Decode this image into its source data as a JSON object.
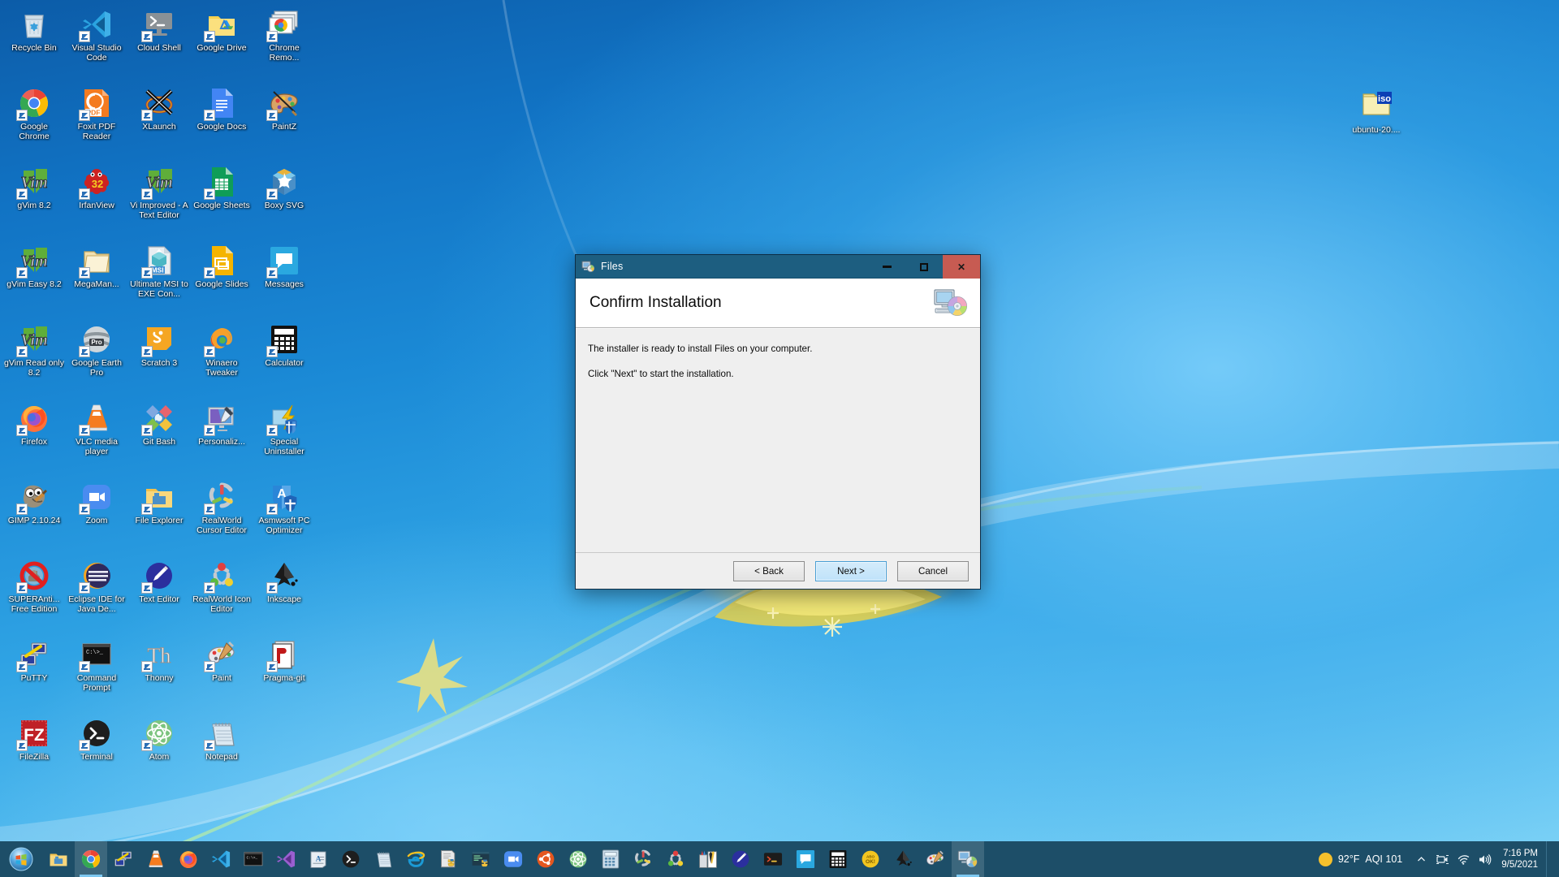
{
  "desktop": {
    "icons": [
      {
        "label": "Recycle Bin",
        "icon": "recycle-bin-icon",
        "shortcut": false
      },
      {
        "label": "Visual Studio Code",
        "icon": "vscode-icon",
        "shortcut": true
      },
      {
        "label": "Cloud Shell",
        "icon": "cloud-shell-icon",
        "shortcut": true
      },
      {
        "label": "Google Drive",
        "icon": "google-drive-icon",
        "shortcut": true
      },
      {
        "label": "Chrome Remo...",
        "icon": "chrome-remote-desktop-icon",
        "shortcut": true
      },
      {
        "label": "Google Chrome",
        "icon": "google-chrome-icon",
        "shortcut": true
      },
      {
        "label": "Foxit PDF Reader",
        "icon": "foxit-pdf-reader-icon",
        "shortcut": true
      },
      {
        "label": "XLaunch",
        "icon": "xlaunch-icon",
        "shortcut": true
      },
      {
        "label": "Google Docs",
        "icon": "google-docs-icon",
        "shortcut": true
      },
      {
        "label": "PaintZ",
        "icon": "paintz-icon",
        "shortcut": true
      },
      {
        "label": "gVim 8.2",
        "icon": "gvim-icon",
        "shortcut": true
      },
      {
        "label": "IrfanView",
        "icon": "irfanview-icon",
        "shortcut": true
      },
      {
        "label": "Vi Improved - A Text Editor",
        "icon": "vim-icon",
        "shortcut": true
      },
      {
        "label": "Google Sheets",
        "icon": "google-sheets-icon",
        "shortcut": true
      },
      {
        "label": "Boxy SVG",
        "icon": "boxy-svg-icon",
        "shortcut": true
      },
      {
        "label": "gVim Easy 8.2",
        "icon": "gvim-easy-icon",
        "shortcut": true
      },
      {
        "label": "MegaMan...",
        "icon": "folder-icon",
        "shortcut": true
      },
      {
        "label": "Ultimate MSI to EXE Con...",
        "icon": "msi-to-exe-icon",
        "shortcut": true
      },
      {
        "label": "Google Slides",
        "icon": "google-slides-icon",
        "shortcut": true
      },
      {
        "label": "Messages",
        "icon": "messages-icon",
        "shortcut": true
      },
      {
        "label": "gVim Read only 8.2",
        "icon": "gvim-readonly-icon",
        "shortcut": true
      },
      {
        "label": "Google Earth Pro",
        "icon": "google-earth-pro-icon",
        "shortcut": true
      },
      {
        "label": "Scratch 3",
        "icon": "scratch-icon",
        "shortcut": true
      },
      {
        "label": "Winaero Tweaker",
        "icon": "winaero-tweaker-icon",
        "shortcut": true
      },
      {
        "label": "Calculator",
        "icon": "calculator-icon",
        "shortcut": true
      },
      {
        "label": "Firefox",
        "icon": "firefox-icon",
        "shortcut": true
      },
      {
        "label": "VLC media player",
        "icon": "vlc-icon",
        "shortcut": true
      },
      {
        "label": "Git Bash",
        "icon": "git-bash-icon",
        "shortcut": true
      },
      {
        "label": "Personaliz...",
        "icon": "personalization-icon",
        "shortcut": true
      },
      {
        "label": "Special Uninstaller",
        "icon": "special-uninstaller-icon",
        "shortcut": true
      },
      {
        "label": "GIMP 2.10.24",
        "icon": "gimp-icon",
        "shortcut": true
      },
      {
        "label": "Zoom",
        "icon": "zoom-icon",
        "shortcut": true
      },
      {
        "label": "File Explorer",
        "icon": "file-explorer-icon",
        "shortcut": true
      },
      {
        "label": "RealWorld Cursor Editor",
        "icon": "realworld-cursor-editor-icon",
        "shortcut": true
      },
      {
        "label": "Asmwsoft PC Optimizer",
        "icon": "asmwsoft-pc-optimizer-icon",
        "shortcut": true
      },
      {
        "label": "SUPERAnti... Free Edition",
        "icon": "superantispyware-icon",
        "shortcut": true
      },
      {
        "label": "Eclipse IDE for Java De...",
        "icon": "eclipse-icon",
        "shortcut": true
      },
      {
        "label": "Text Editor",
        "icon": "text-editor-icon",
        "shortcut": true
      },
      {
        "label": "RealWorld Icon Editor",
        "icon": "realworld-icon-editor-icon",
        "shortcut": true
      },
      {
        "label": "Inkscape",
        "icon": "inkscape-icon",
        "shortcut": true
      },
      {
        "label": "PuTTY",
        "icon": "putty-icon",
        "shortcut": true
      },
      {
        "label": "Command Prompt",
        "icon": "command-prompt-icon",
        "shortcut": true
      },
      {
        "label": "Thonny",
        "icon": "thonny-icon",
        "shortcut": true
      },
      {
        "label": "Paint",
        "icon": "paint-icon",
        "shortcut": true
      },
      {
        "label": "Pragma-git",
        "icon": "pragma-git-icon",
        "shortcut": true
      },
      {
        "label": "FileZilla",
        "icon": "filezilla-icon",
        "shortcut": true
      },
      {
        "label": "Terminal",
        "icon": "terminal-icon",
        "shortcut": true
      },
      {
        "label": "Atom",
        "icon": "atom-icon",
        "shortcut": true
      },
      {
        "label": "Notepad",
        "icon": "notepad-icon",
        "shortcut": true
      }
    ],
    "iso_file": {
      "label": "ubuntu-20....",
      "icon": "iso-file-icon"
    }
  },
  "dialog": {
    "window_title": "Files",
    "title_icon": "installer-icon",
    "header_title": "Confirm Installation",
    "header_icon": "computer-cd-icon",
    "body_line_1": "The installer is ready to install Files on your computer.",
    "body_line_2": "Click \"Next\" to start the installation.",
    "buttons": {
      "back": "< Back",
      "next": "Next >",
      "cancel": "Cancel"
    },
    "window_controls": {
      "minimize": "minimize-icon",
      "maximize": "maximize-icon",
      "close": "✕"
    },
    "colors": {
      "titlebar": "#1d5e80",
      "close_button": "#c75b52",
      "primary_button": "#bfe2fa",
      "body": "#efefef"
    }
  },
  "taskbar": {
    "start_label": "start-orb",
    "items": [
      {
        "name": "file-explorer",
        "icon": "file-explorer-icon",
        "active": false
      },
      {
        "name": "google-chrome",
        "icon": "google-chrome-icon",
        "active": true
      },
      {
        "name": "putty",
        "icon": "putty-icon",
        "active": false
      },
      {
        "name": "vlc-media-player",
        "icon": "vlc-icon",
        "active": false
      },
      {
        "name": "firefox",
        "icon": "firefox-icon",
        "active": false
      },
      {
        "name": "visual-studio-code",
        "icon": "vscode-icon",
        "active": false
      },
      {
        "name": "command-prompt",
        "icon": "command-prompt-icon",
        "active": false
      },
      {
        "name": "visual-studio",
        "icon": "visual-studio-icon",
        "active": false
      },
      {
        "name": "wordpad",
        "icon": "wordpad-icon",
        "active": false
      },
      {
        "name": "terminal",
        "icon": "terminal-icon",
        "active": false
      },
      {
        "name": "notepad",
        "icon": "notepad-icon",
        "active": false
      },
      {
        "name": "internet-explorer",
        "icon": "internet-explorer-icon",
        "active": false
      },
      {
        "name": "python-idle",
        "icon": "python-idle-icon",
        "active": false
      },
      {
        "name": "python-shell",
        "icon": "python-shell-icon",
        "active": false
      },
      {
        "name": "zoom",
        "icon": "zoom-icon",
        "active": false
      },
      {
        "name": "ubuntu",
        "icon": "ubuntu-icon",
        "active": false
      },
      {
        "name": "atom",
        "icon": "atom-icon",
        "active": false
      },
      {
        "name": "calculator-classic",
        "icon": "calculator-classic-icon",
        "active": false
      },
      {
        "name": "realworld-cursor-editor",
        "icon": "realworld-cursor-editor-icon",
        "active": false
      },
      {
        "name": "realworld-icon-editor",
        "icon": "realworld-icon-editor-icon",
        "active": false
      },
      {
        "name": "paint-tools",
        "icon": "paint-tools-icon",
        "active": false
      },
      {
        "name": "text-editor",
        "icon": "text-editor-icon",
        "active": false
      },
      {
        "name": "terminal-2",
        "icon": "terminal-alt-icon",
        "active": false
      },
      {
        "name": "messages",
        "icon": "messages-icon",
        "active": false
      },
      {
        "name": "calculator",
        "icon": "calculator-icon",
        "active": false
      },
      {
        "name": "abook-ok",
        "icon": "abook-ok-icon",
        "active": false
      },
      {
        "name": "inkscape",
        "icon": "inkscape-icon",
        "active": false
      },
      {
        "name": "paint",
        "icon": "paint-icon",
        "active": false
      },
      {
        "name": "installer-files",
        "icon": "installer-icon",
        "active": true
      }
    ],
    "tray": {
      "weather_temp": "92°F",
      "weather_aqi": "AQI 101",
      "chevron": "show-hidden-icons",
      "icons": [
        "meet-camera-icon",
        "wifi-icon",
        "volume-icon"
      ],
      "time": "7:16 PM",
      "date": "9/5/2021"
    }
  }
}
